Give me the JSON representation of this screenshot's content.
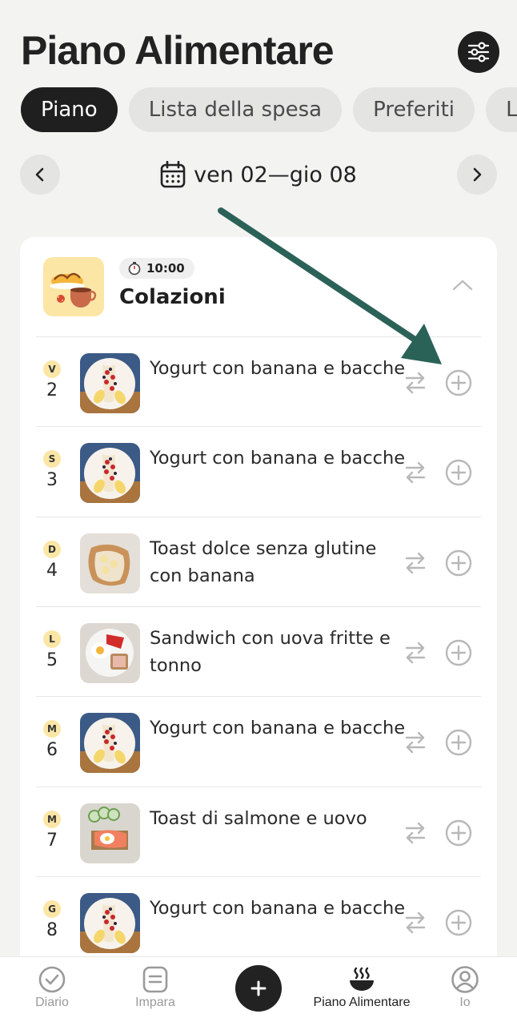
{
  "header": {
    "title": "Piano Alimentare"
  },
  "tabs": [
    {
      "label": "Piano",
      "active": true
    },
    {
      "label": "Lista della spesa",
      "active": false
    },
    {
      "label": "Preferiti",
      "active": false
    },
    {
      "label": "L",
      "active": false
    }
  ],
  "week": {
    "label": "ven 02—gio 08"
  },
  "meal": {
    "time": "10:00",
    "title": "Colazioni"
  },
  "rows": [
    {
      "day_letter": "V",
      "day_num": "2",
      "name": "Yogurt con banana e bacche",
      "image": "yogurt"
    },
    {
      "day_letter": "S",
      "day_num": "3",
      "name": "Yogurt con banana e bacche",
      "image": "yogurt"
    },
    {
      "day_letter": "D",
      "day_num": "4",
      "name": "Toast dolce senza glutine con banana",
      "image": "toast"
    },
    {
      "day_letter": "L",
      "day_num": "5",
      "name": "Sandwich con uova fritte e tonno",
      "image": "sandwich"
    },
    {
      "day_letter": "M",
      "day_num": "6",
      "name": "Yogurt con banana e bacche",
      "image": "yogurt"
    },
    {
      "day_letter": "M",
      "day_num": "7",
      "name": "Toast di salmone e uovo",
      "image": "salmon"
    },
    {
      "day_letter": "G",
      "day_num": "8",
      "name": "Yogurt con banana e bacche",
      "image": "yogurt"
    }
  ],
  "bottom_nav": [
    {
      "label": "Diario",
      "icon": "check-circle-icon",
      "active": false
    },
    {
      "label": "Impara",
      "icon": "book-icon",
      "active": false
    },
    {
      "label": "",
      "icon": "plus-icon",
      "active": false
    },
    {
      "label": "Piano Alimentare",
      "icon": "bowl-icon",
      "active": true
    },
    {
      "label": "Io",
      "icon": "profile-icon",
      "active": false
    }
  ],
  "colors": {
    "background": "#f3f3f2",
    "dark": "#1f1f1f",
    "day_badge": "#fbe6a6",
    "annotation_arrow": "#2b6258"
  }
}
